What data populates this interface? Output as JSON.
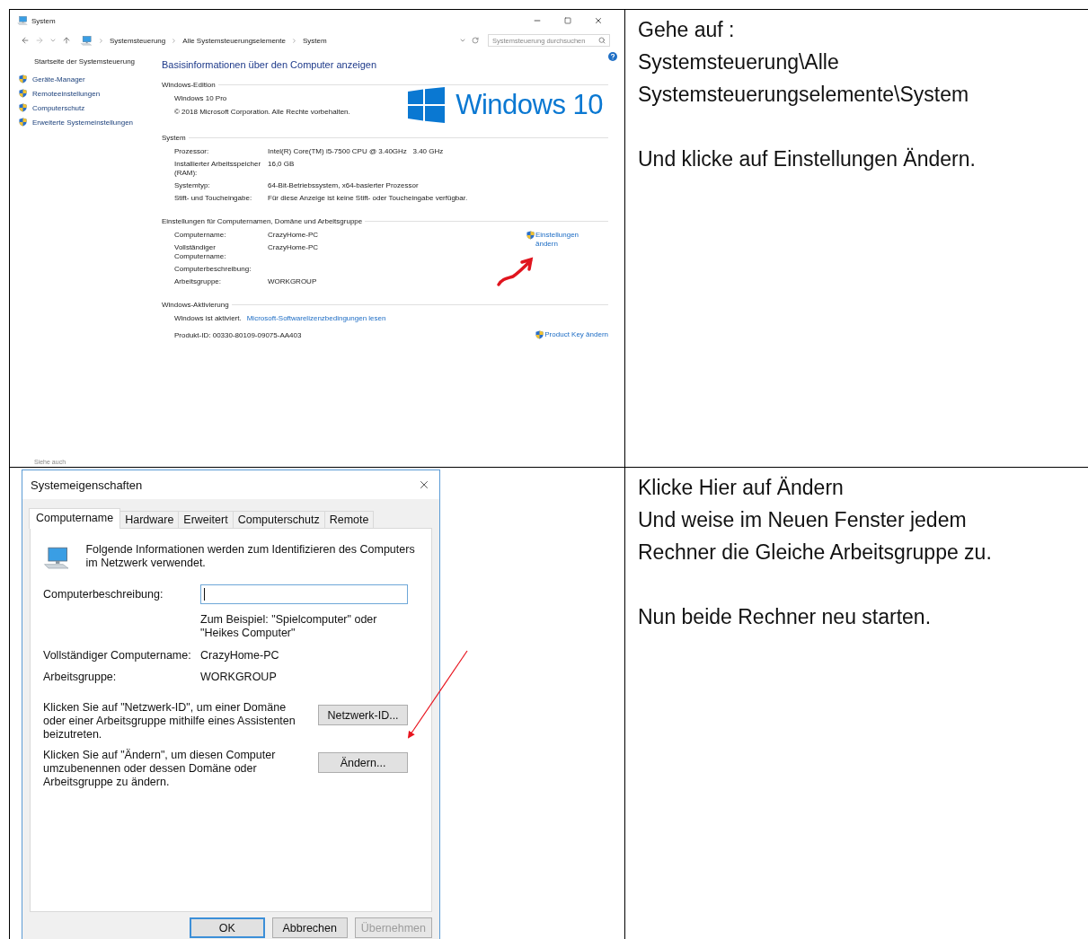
{
  "system_window": {
    "title": "System",
    "breadcrumb": [
      "Systemsteuerung",
      "Alle Systemsteuerungselemente",
      "System"
    ],
    "search": {
      "placeholder": "Systemsteuerung durchsuchen"
    },
    "sidebar": {
      "home": "Startseite der Systemsteuerung",
      "links": [
        "Geräte-Manager",
        "Remoteeinstellungen",
        "Computerschutz",
        "Erweiterte Systemeinstellungen"
      ],
      "see_also": "Siehe auch"
    },
    "heading": "Basisinformationen über den Computer anzeigen",
    "edition": {
      "title": "Windows-Edition",
      "lines": [
        "Windows 10 Pro",
        "© 2018 Microsoft Corporation. Alle Rechte vorbehalten."
      ],
      "logo": "Windows 10"
    },
    "system": {
      "title": "System",
      "rows": [
        {
          "label": "Prozessor:",
          "value": "Intel(R) Core(TM) i5-7500 CPU @ 3.40GHz   3.40 GHz"
        },
        {
          "label": "Installierter Arbeitsspeicher (RAM):",
          "value": "16,0 GB"
        },
        {
          "label": "Systemtyp:",
          "value": "64-Bit-Betriebssystem, x64-basierter Prozessor"
        },
        {
          "label": "Stift- und Toucheingabe:",
          "value": "Für diese Anzeige ist keine Stift- oder Toucheingabe verfügbar."
        }
      ]
    },
    "computer_name": {
      "title": "Einstellungen für Computernamen, Domäne und Arbeitsgruppe",
      "rows": [
        {
          "label": "Computername:",
          "value": "CrazyHome-PC"
        },
        {
          "label": "Vollständiger Computername:",
          "value": "CrazyHome-PC"
        },
        {
          "label": "Computerbeschreibung:"
        },
        {
          "label": "Arbeitsgruppe:",
          "value": "WORKGROUP"
        }
      ],
      "action": "Einstellungen ändern"
    },
    "activation": {
      "title": "Windows-Aktivierung",
      "status": "Windows ist aktiviert.",
      "license_link": "Microsoft-Softwarelizenzbedingungen lesen",
      "product_id": "Produkt-ID: 00330-80109-09075-AA403",
      "action": "Product Key ändern"
    }
  },
  "instructions_1": [
    [
      "Gehe auf :",
      "Systemsteuerung\\Alle",
      "Systemsteuerungselemente\\System"
    ],
    [
      "Und klicke auf Einstellungen Ändern."
    ]
  ],
  "properties_dialog": {
    "title": "Systemeigenschaften",
    "tabs": [
      {
        "label": "Computername",
        "selected": true
      },
      {
        "label": "Hardware",
        "selected": false
      },
      {
        "label": "Erweitert",
        "selected": false
      },
      {
        "label": "Computerschutz",
        "selected": false
      },
      {
        "label": "Remote",
        "selected": false
      }
    ],
    "intro": "Folgende Informationen werden zum Identifizieren des Computers im Netzwerk verwendet.",
    "description": {
      "label": "Computerbeschreibung:",
      "hint": "Zum Beispiel: \"Spielcomputer\" oder \"Heikes Computer\""
    },
    "rows": [
      {
        "label": "Vollständiger Computername:",
        "value": "CrazyHome-PC"
      },
      {
        "label": "Arbeitsgruppe:",
        "value": "WORKGROUP"
      }
    ],
    "actions": [
      {
        "text": "Klicken Sie auf \"Netzwerk-ID\", um einer Domäne oder einer Arbeitsgruppe mithilfe eines Assistenten beizutreten.",
        "button": "Netzwerk-ID..."
      },
      {
        "text": "Klicken Sie auf \"Ändern\", um diesen Computer umzubenennen oder dessen Domäne oder Arbeitsgruppe zu ändern.",
        "button": "Ändern..."
      }
    ],
    "buttons": [
      {
        "label": "OK",
        "default": true,
        "disabled": false
      },
      {
        "label": "Abbrechen",
        "default": false,
        "disabled": false
      },
      {
        "label": "Übernehmen",
        "default": false,
        "disabled": true
      }
    ]
  },
  "instructions_2": [
    [
      "Klicke Hier auf Ändern",
      "Und weise im Neuen Fenster jedem",
      "Rechner die Gleiche Arbeitsgruppe zu."
    ],
    [
      "Nun beide Rechner neu starten."
    ]
  ]
}
